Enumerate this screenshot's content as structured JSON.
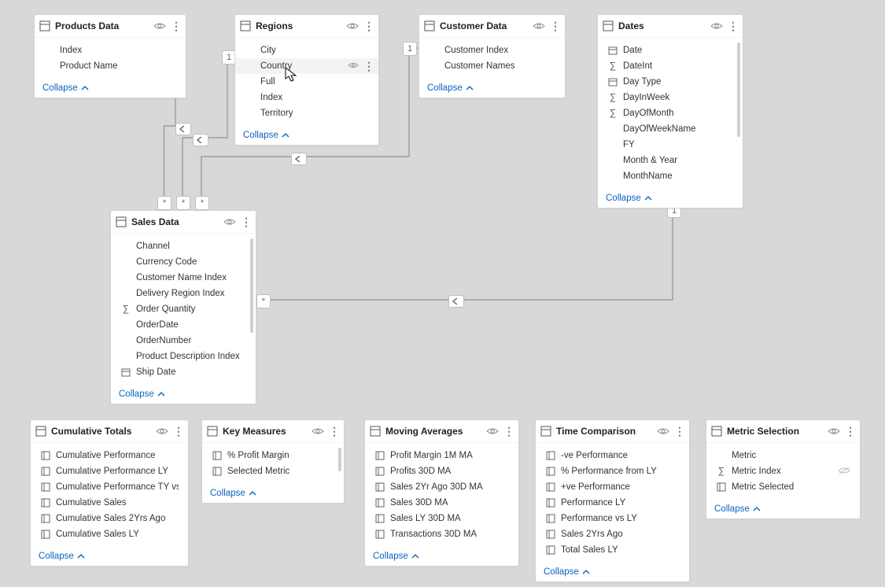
{
  "collapse_label": "Collapse",
  "cards": {
    "products": {
      "title": "Products Data",
      "fields": [
        "Index",
        "Product Name"
      ],
      "icons": [
        "",
        ""
      ]
    },
    "regions": {
      "title": "Regions",
      "fields": [
        "City",
        "Country",
        "Full",
        "Index",
        "Territory"
      ],
      "icons": [
        "",
        "",
        "",
        "",
        ""
      ],
      "selected": 1
    },
    "customer": {
      "title": "Customer Data",
      "fields": [
        "Customer Index",
        "Customer Names"
      ],
      "icons": [
        "",
        ""
      ]
    },
    "dates": {
      "title": "Dates",
      "fields": [
        "Date",
        "DateInt",
        "Day Type",
        "DayInWeek",
        "DayOfMonth",
        "DayOfWeekName",
        "FY",
        "Month & Year",
        "MonthName"
      ],
      "icons": [
        "cal",
        "sum",
        "cal2",
        "sum",
        "sum",
        "",
        "",
        "",
        ""
      ]
    },
    "sales": {
      "title": "Sales Data",
      "fields": [
        "Channel",
        "Currency Code",
        "Customer Name Index",
        "Delivery Region Index",
        "Order Quantity",
        "OrderDate",
        "OrderNumber",
        "Product Description Index",
        "Ship Date"
      ],
      "icons": [
        "",
        "",
        "",
        "",
        "sum",
        "",
        "",
        "",
        "cal"
      ]
    },
    "cum": {
      "title": "Cumulative Totals",
      "fields": [
        "Cumulative Performance",
        "Cumulative Performance LY",
        "Cumulative Performance TY vs LY",
        "Cumulative Sales",
        "Cumulative Sales 2Yrs Ago",
        "Cumulative Sales LY"
      ],
      "icons": [
        "m",
        "m",
        "m",
        "m",
        "m",
        "m"
      ]
    },
    "key": {
      "title": "Key Measures",
      "fields": [
        "% Profit Margin",
        "Selected Metric"
      ],
      "icons": [
        "m",
        "m"
      ]
    },
    "mov": {
      "title": "Moving Averages",
      "fields": [
        "Profit Margin 1M MA",
        "Profits 30D MA",
        "Sales 2Yr Ago 30D MA",
        "Sales 30D MA",
        "Sales LY 30D MA",
        "Transactions 30D MA"
      ],
      "icons": [
        "m",
        "m",
        "m",
        "m",
        "m",
        "m"
      ]
    },
    "time": {
      "title": "Time Comparison",
      "fields": [
        "-ve Performance",
        "% Performance from LY",
        "+ve Performance",
        "Performance LY",
        "Performance vs LY",
        "Sales 2Yrs Ago",
        "Total Sales LY"
      ],
      "icons": [
        "m",
        "m",
        "m",
        "m",
        "m",
        "m",
        "m"
      ]
    },
    "metric": {
      "title": "Metric Selection",
      "fields": [
        "Metric",
        "Metric Index",
        "Metric Selected"
      ],
      "icons": [
        "",
        "sum",
        "m"
      ],
      "hidden": 1
    }
  },
  "endpoints": {
    "one": "1",
    "many": "*"
  }
}
